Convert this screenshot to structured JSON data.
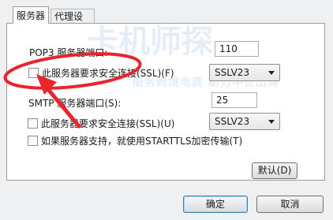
{
  "tabs": [
    {
      "label": "服务器"
    },
    {
      "label": "代理设置"
    }
  ],
  "pop3": {
    "port_label": "POP3 服务器端口:",
    "port_value": "110",
    "ssl_label": "此服务器要求安全连接(SSL)(F)",
    "ssl_checked": false,
    "ssl_version": "SSLV23"
  },
  "smtp": {
    "port_label": "SMTP 服务器端口(S):",
    "port_value": "25",
    "ssl_label": "此服务器要求安全连接(SSL)(U)",
    "ssl_checked": false,
    "ssl_version": "SSLV23"
  },
  "starttls": {
    "label": "如果服务器支持，就使用STARTTLS加密传输(T)",
    "checked": false
  },
  "buttons": {
    "default": "默认(D)",
    "ok": "确定",
    "cancel": "取消"
  },
  "watermark": {
    "line1": "卡机师探",
    "line2": "服务跨境电商  助力中企出海"
  },
  "colors": {
    "annotation": "#e8252a",
    "watermark": "#5a8cd2"
  }
}
